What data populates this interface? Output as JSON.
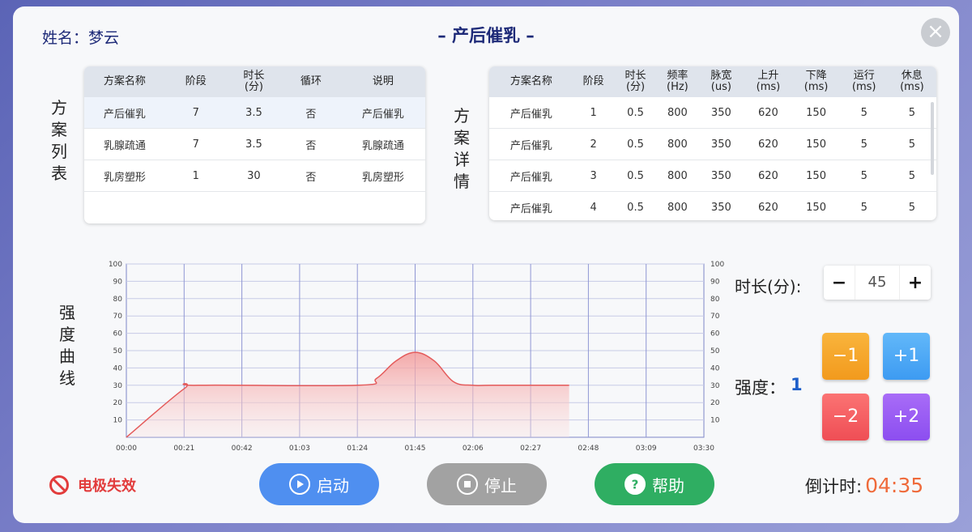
{
  "patient": {
    "label": "姓名：梦云"
  },
  "window": {
    "title": "– 产后催乳 –"
  },
  "labels": {
    "plan_list": [
      "方",
      "案",
      "列",
      "表"
    ],
    "plan_detail": [
      "方",
      "案",
      "详",
      "情"
    ],
    "intensity_curve": [
      "强",
      "度",
      "曲",
      "线"
    ]
  },
  "plan_list": {
    "headers": [
      [
        "方案名称"
      ],
      [
        "阶段"
      ],
      [
        "时长",
        "(分)"
      ],
      [
        "循环"
      ],
      [
        "说明"
      ]
    ],
    "rows": [
      [
        "产后催乳",
        "7",
        "3.5",
        "否",
        "产后催乳"
      ],
      [
        "乳腺疏通",
        "7",
        "3.5",
        "否",
        "乳腺疏通"
      ],
      [
        "乳房塑形",
        "1",
        "30",
        "否",
        "乳房塑形"
      ]
    ]
  },
  "plan_detail": {
    "headers": [
      [
        "方案名称"
      ],
      [
        "阶段"
      ],
      [
        "时长",
        "(分)"
      ],
      [
        "频率",
        "(Hz)"
      ],
      [
        "脉宽",
        "(us)"
      ],
      [
        "上升",
        "(ms)"
      ],
      [
        "下降",
        "(ms)"
      ],
      [
        "运行",
        "(ms)"
      ],
      [
        "休息",
        "(ms)"
      ]
    ],
    "rows": [
      [
        "产后催乳",
        "1",
        "0.5",
        "800",
        "350",
        "620",
        "150",
        "5",
        "5"
      ],
      [
        "产后催乳",
        "2",
        "0.5",
        "800",
        "350",
        "620",
        "150",
        "5",
        "5"
      ],
      [
        "产后催乳",
        "3",
        "0.5",
        "800",
        "350",
        "620",
        "150",
        "5",
        "5"
      ],
      [
        "产后催乳",
        "4",
        "0.5",
        "800",
        "350",
        "620",
        "150",
        "5",
        "5"
      ]
    ]
  },
  "chart_data": {
    "type": "area",
    "x_ticks": [
      "00:00",
      "00:21",
      "00:42",
      "01:03",
      "01:24",
      "01:45",
      "02:06",
      "02:27",
      "02:48",
      "03:09",
      "03:30"
    ],
    "y_ticks": [
      10,
      20,
      30,
      40,
      50,
      60,
      70,
      80,
      90,
      100
    ],
    "ylim": [
      0,
      100
    ],
    "xlim_seconds": [
      0,
      210
    ],
    "series": [
      {
        "x": [
          0,
          21,
          26,
          84,
          91,
          98,
          105,
          112,
          119,
          126,
          133,
          161
        ],
        "y": [
          0,
          28,
          30,
          30,
          34,
          44,
          49,
          44,
          32,
          30,
          30,
          30
        ],
        "color": "#e45b5b"
      }
    ],
    "grid": true
  },
  "duration": {
    "label": "时长(分):",
    "value": "45",
    "minus": "−",
    "plus": "+"
  },
  "intensity": {
    "label": "强度：",
    "value": "1",
    "minus1": "−1",
    "plus1": "+1",
    "minus2": "−2",
    "plus2": "+2"
  },
  "status": {
    "electrode": "电极失效"
  },
  "buttons": {
    "start": "启动",
    "stop": "停止",
    "help": "帮助"
  },
  "countdown": {
    "label": "倒计时:",
    "value": "04:35"
  },
  "colors": {
    "accent": "#1e2a78",
    "start": "#4f8ff0",
    "stop": "#a2a2a2",
    "help": "#2fae62",
    "countdown": "#ef6a3a",
    "error": "#e23c3c"
  }
}
